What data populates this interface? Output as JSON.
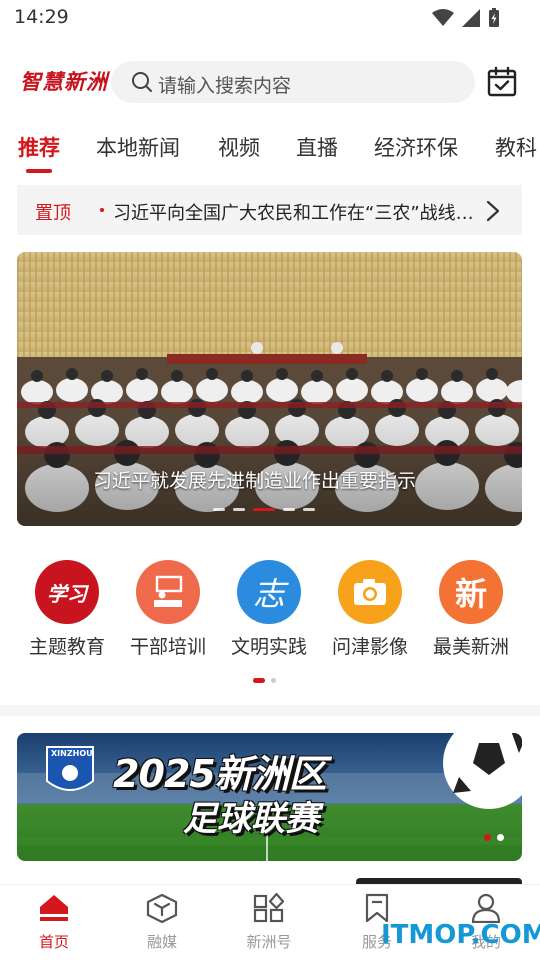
{
  "status_bar": {
    "time": "14:29"
  },
  "header": {
    "logo_text": "智慧新洲",
    "search_placeholder": "请输入搜索内容"
  },
  "tabs": [
    {
      "label": "推荐",
      "active": true
    },
    {
      "label": "本地新闻"
    },
    {
      "label": "视频"
    },
    {
      "label": "直播"
    },
    {
      "label": "经济环保"
    },
    {
      "label": "教科"
    }
  ],
  "pinned": {
    "tag": "置顶",
    "text": "习近平向全国广大农民和工作在“三农”战线上的同志们致以节日祝贺和诚挚慰问"
  },
  "banner": {
    "caption": "习近平就发展先进制造业作出重要指示",
    "slide_count": 5,
    "active_slide": 3
  },
  "quick_links": [
    {
      "label": "主题教育",
      "glyph": "学习",
      "color": "#c8141e",
      "icon": "study-icon"
    },
    {
      "label": "干部培训",
      "glyph": "",
      "color": "#ef6a4a",
      "icon": "training-icon"
    },
    {
      "label": "文明实践",
      "glyph": "志",
      "color": "#2a8bdf",
      "icon": "volunteer-icon"
    },
    {
      "label": "问津影像",
      "glyph": "",
      "color": "#f7a21b",
      "icon": "camera-icon"
    },
    {
      "label": "最美新洲",
      "glyph": "新",
      "color": "#f27333",
      "icon": "xin-icon"
    }
  ],
  "quick_pager": {
    "pages": 2,
    "active": 1
  },
  "football_banner": {
    "title_line1": "2025新洲区",
    "title_line2": "足球联赛",
    "badge_text": "XINZHOU",
    "slide_count": 2,
    "active_slide": 1
  },
  "bottom_nav": [
    {
      "label": "首页",
      "icon": "home-icon",
      "active": true
    },
    {
      "label": "融媒",
      "icon": "media-cube-icon"
    },
    {
      "label": "新洲号",
      "icon": "apps-grid-icon"
    },
    {
      "label": "服务",
      "icon": "bookmark-icon"
    },
    {
      "label": "我的",
      "icon": "user-icon"
    }
  ],
  "watermark": "ITMOP.COM",
  "colors": {
    "accent": "#d4171c",
    "watermark": "#1598d6"
  }
}
